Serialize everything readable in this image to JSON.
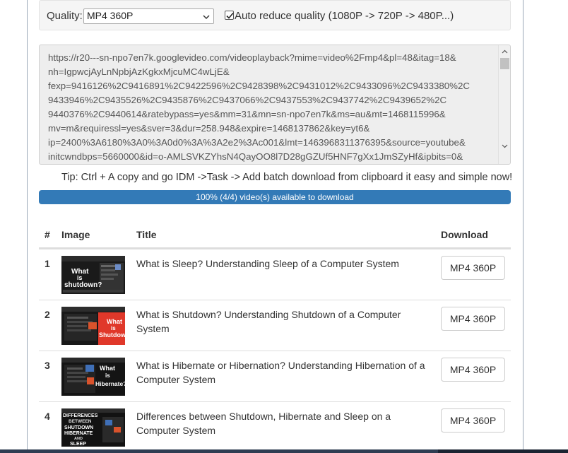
{
  "quality": {
    "label": "Quality:",
    "selected": "MP4 360P",
    "auto_reduce_checked": true,
    "auto_reduce_label": "Auto reduce quality (1080P -> 720P -> 480P...)"
  },
  "url_lines": [
    "https://r20---sn-npo7en7k.googlevideo.com/videoplayback?mime=video%2Fmp4&pl=48&itag=18&",
    "nh=IgpwcjAyLnNpbjAzKgkxMjcuMC4wLjE&",
    "fexp=9416126%2C9416891%2C9422596%2C9428398%2C9431012%2C9433096%2C9433380%2C",
    "9433946%2C9435526%2C9435876%2C9437066%2C9437553%2C9437742%2C9439652%2C",
    "9440376%2C9440614&ratebypass=yes&mm=31&mn=sn-npo7en7k&ms=au&mt=1468115996&",
    "mv=m&requiressl=yes&sver=3&dur=258.948&expire=1468137862&key=yt6&",
    "ip=2400%3A6180%3A0%3A0d0%3A%3A2e2%3Ac001&lmt=1463968311376395&source=youtube&",
    "initcwndbps=5660000&id=o-AMLSVKZYhsN4QayOO8l7D28gGZUf5HNF7gXx1JmSZyHf&ipbits=0&"
  ],
  "tip": "Tip: Ctrl + A copy and go IDM ->Task -> Add batch download from clipboard it easy and simple now!",
  "progress": {
    "percent": 100,
    "text": "100% (4/4) video(s) available to download",
    "color": "#337ab7"
  },
  "table": {
    "headers": {
      "num": "#",
      "image": "Image",
      "title": "Title",
      "download": "Download"
    },
    "rows": [
      {
        "num": "1",
        "title": "What is Sleep? Understanding Sleep of a Computer System",
        "download": "MP4 360P",
        "thumb_text": [
          "What",
          "is",
          "shutdown?"
        ]
      },
      {
        "num": "2",
        "title": "What is Shutdown? Understanding Shutdown of a Computer System",
        "download": "MP4 360P",
        "thumb_text": [
          "What",
          "is",
          "Shutdown"
        ]
      },
      {
        "num": "3",
        "title": "What is Hibernate or Hibernation? Understanding Hibernation of a Computer System",
        "download": "MP4 360P",
        "thumb_text": [
          "What",
          "is",
          "Hibernate?"
        ]
      },
      {
        "num": "4",
        "title": "Differences between Shutdown, Hibernate and Sleep on a Computer System",
        "download": "MP4 360P",
        "thumb_text": [
          "DIFFERENCES",
          "BETWEEN",
          "SHUTDOWN",
          "HIBERNATE",
          "AND",
          "SLEEP"
        ]
      }
    ]
  }
}
